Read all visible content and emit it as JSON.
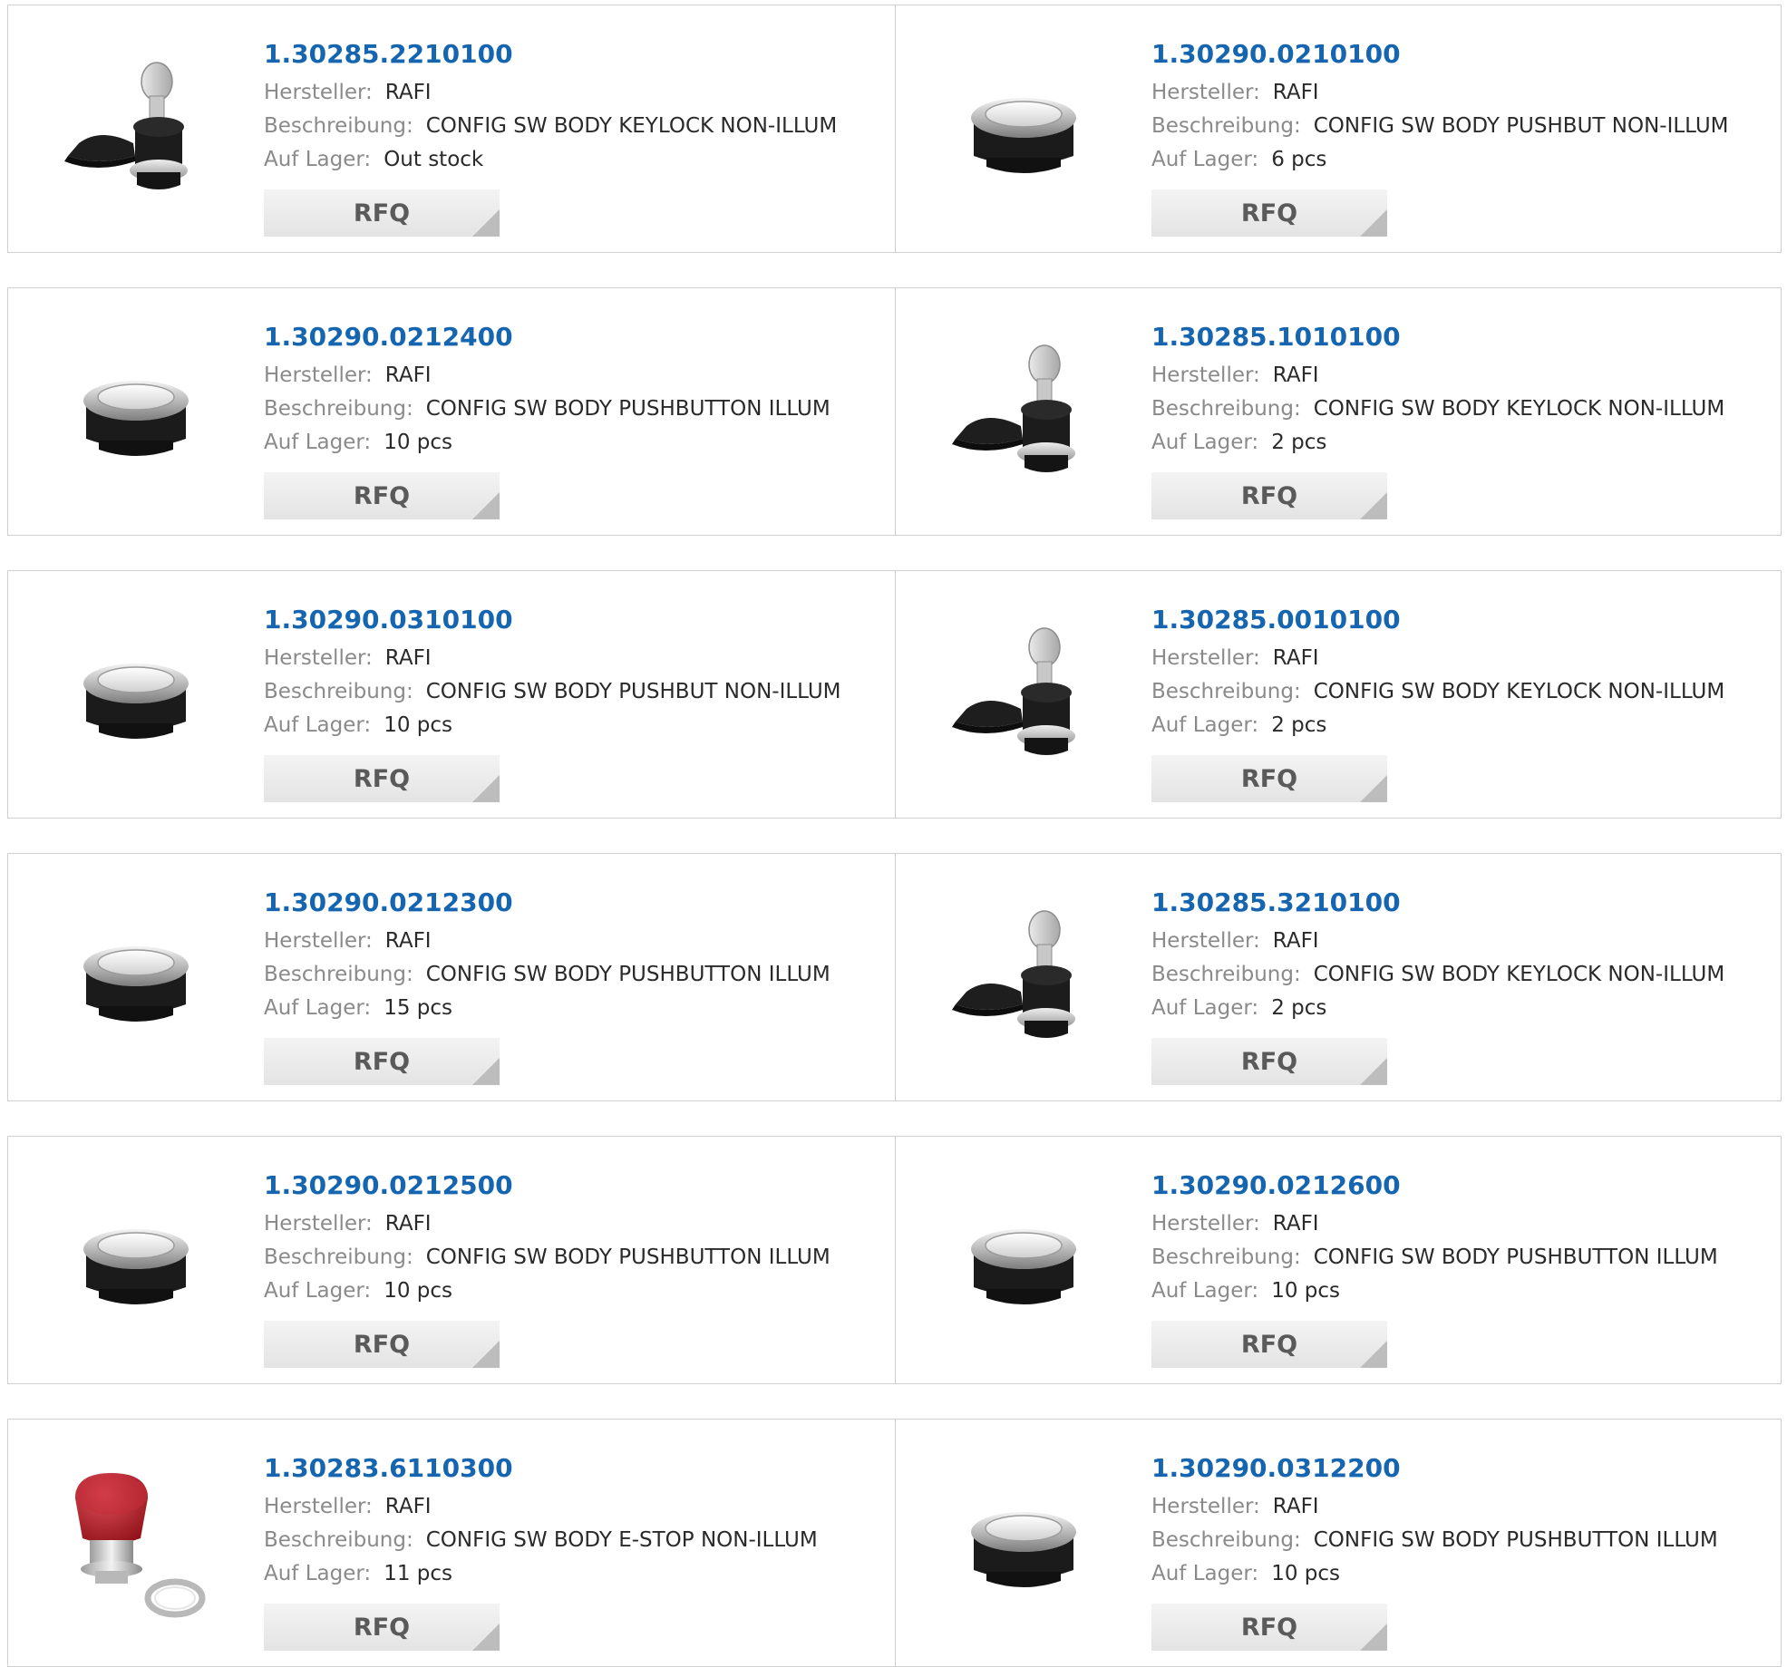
{
  "labels": {
    "manufacturer": "Hersteller:",
    "description": "Beschreibung:",
    "stock": "Auf Lager:",
    "rfq": "RFQ"
  },
  "products": [
    {
      "part_number": "1.30285.2210100",
      "manufacturer": "RAFI",
      "description": "CONFIG SW BODY KEYLOCK NON-ILLUM",
      "stock": "Out stock",
      "image": "keylock-switch-image"
    },
    {
      "part_number": "1.30290.0210100",
      "manufacturer": "RAFI",
      "description": "CONFIG SW BODY PUSHBUT NON-ILLUM",
      "stock": "6 pcs",
      "image": "pushbutton-image"
    },
    {
      "part_number": "1.30290.0212400",
      "manufacturer": "RAFI",
      "description": "CONFIG SW BODY PUSHBUTTON ILLUM",
      "stock": "10 pcs",
      "image": "pushbutton-image"
    },
    {
      "part_number": "1.30285.1010100",
      "manufacturer": "RAFI",
      "description": "CONFIG SW BODY KEYLOCK NON-ILLUM",
      "stock": "2 pcs",
      "image": "keylock-switch-image"
    },
    {
      "part_number": "1.30290.0310100",
      "manufacturer": "RAFI",
      "description": "CONFIG SW BODY PUSHBUT NON-ILLUM",
      "stock": "10 pcs",
      "image": "pushbutton-image"
    },
    {
      "part_number": "1.30285.0010100",
      "manufacturer": "RAFI",
      "description": "CONFIG SW BODY KEYLOCK NON-ILLUM",
      "stock": "2 pcs",
      "image": "keylock-switch-image"
    },
    {
      "part_number": "1.30290.0212300",
      "manufacturer": "RAFI",
      "description": "CONFIG SW BODY PUSHBUTTON ILLUM",
      "stock": "15 pcs",
      "image": "pushbutton-image"
    },
    {
      "part_number": "1.30285.3210100",
      "manufacturer": "RAFI",
      "description": "CONFIG SW BODY KEYLOCK NON-ILLUM",
      "stock": "2 pcs",
      "image": "keylock-switch-image"
    },
    {
      "part_number": "1.30290.0212500",
      "manufacturer": "RAFI",
      "description": "CONFIG SW BODY PUSHBUTTON ILLUM",
      "stock": "10 pcs",
      "image": "pushbutton-image"
    },
    {
      "part_number": "1.30290.0212600",
      "manufacturer": "RAFI",
      "description": "CONFIG SW BODY PUSHBUTTON ILLUM",
      "stock": "10 pcs",
      "image": "pushbutton-image"
    },
    {
      "part_number": "1.30283.6110300",
      "manufacturer": "RAFI",
      "description": "CONFIG SW BODY E-STOP NON-ILLUM",
      "stock": "11 pcs",
      "image": "estop-button-image"
    },
    {
      "part_number": "1.30290.0312200",
      "manufacturer": "RAFI",
      "description": "CONFIG SW BODY PUSHBUTTON ILLUM",
      "stock": "10 pcs",
      "image": "pushbutton-image"
    }
  ],
  "colors": {
    "part_number_link": "#1565b0",
    "label_text": "#8a8a8a",
    "value_text": "#2a2a2a",
    "border": "#cfcfcf",
    "rfq_background": "#e9e9e9",
    "rfq_text": "#5a5a5a"
  }
}
